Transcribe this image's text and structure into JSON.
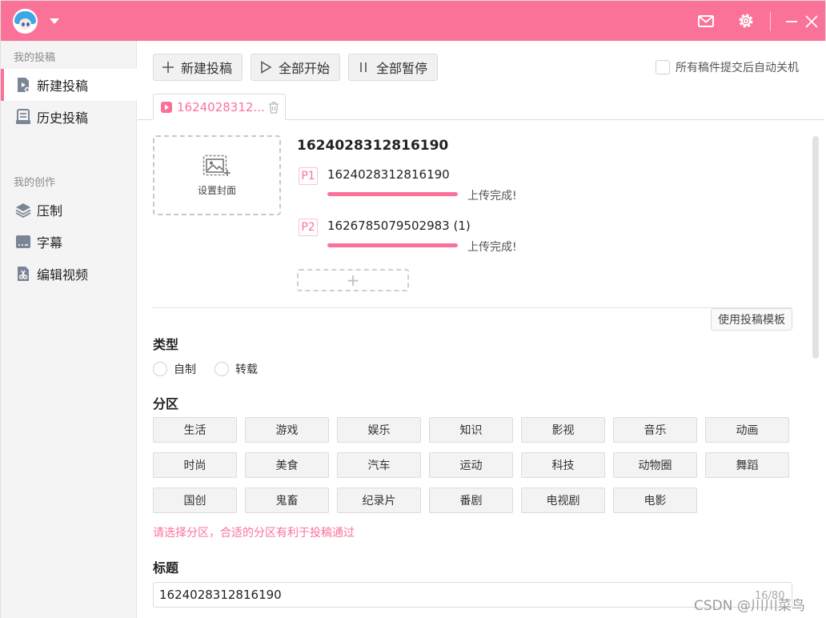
{
  "titlebar": {
    "accent": "#fb7299"
  },
  "sidebar": {
    "group_posts": "我的投稿",
    "group_create": "我的创作",
    "items": [
      {
        "label": "新建投稿",
        "icon": "new-post-icon",
        "active": true
      },
      {
        "label": "历史投稿",
        "icon": "history-icon",
        "active": false
      },
      {
        "label": "压制",
        "icon": "layers-icon",
        "active": false
      },
      {
        "label": "字幕",
        "icon": "subtitle-icon",
        "active": false
      },
      {
        "label": "编辑视频",
        "icon": "edit-video-icon",
        "active": false
      }
    ]
  },
  "toolbar": {
    "new_post": "新建投稿",
    "start_all": "全部开始",
    "pause_all": "全部暂停",
    "auto_shutdown": "所有稿件提交后自动关机"
  },
  "file_tab": {
    "label": "1624028312..."
  },
  "upload": {
    "cover_label": "设置封面",
    "video_title": "1624028312816190",
    "parts": [
      {
        "tag": "P1",
        "name": "1624028312816190",
        "progress": 1.0,
        "status": "上传完成!"
      },
      {
        "tag": "P2",
        "name": "1626785079502983 (1)",
        "progress": 1.0,
        "status": "上传完成!"
      }
    ],
    "add_part": "+"
  },
  "template_button": "使用投稿模板",
  "type_section": {
    "label": "类型",
    "options": [
      "自制",
      "转载"
    ]
  },
  "zone_section": {
    "label": "分区",
    "zones": [
      "生活",
      "游戏",
      "娱乐",
      "知识",
      "影视",
      "音乐",
      "动画",
      "时尚",
      "美食",
      "汽车",
      "运动",
      "科技",
      "动物圈",
      "舞蹈",
      "国创",
      "鬼畜",
      "纪录片",
      "番剧",
      "电视剧",
      "电影"
    ],
    "hint": "请选择分区，合适的分区有利于投稿通过"
  },
  "title_section": {
    "label": "标题",
    "value": "1624028312816190",
    "count": "16/80"
  },
  "watermark": "CSDN @川川菜鸟"
}
